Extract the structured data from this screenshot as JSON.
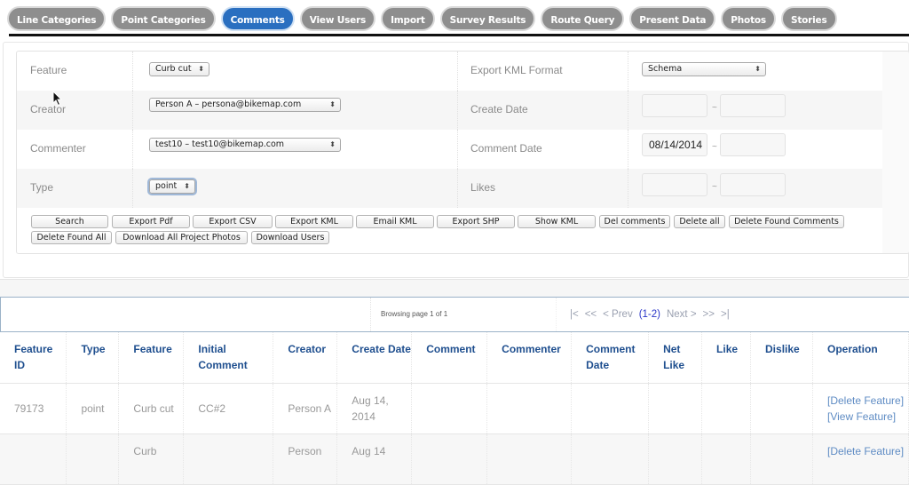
{
  "tabs": [
    {
      "label": "Line Categories",
      "active": false
    },
    {
      "label": "Point Categories",
      "active": false
    },
    {
      "label": "Comments",
      "active": true
    },
    {
      "label": "View Users",
      "active": false
    },
    {
      "label": "Import",
      "active": false
    },
    {
      "label": "Survey Results",
      "active": false
    },
    {
      "label": "Route Query",
      "active": false
    },
    {
      "label": "Present Data",
      "active": false
    },
    {
      "label": "Photos",
      "active": false
    },
    {
      "label": "Stories",
      "active": false
    }
  ],
  "filters": {
    "feature": {
      "label": "Feature",
      "value": "Curb cut"
    },
    "creator": {
      "label": "Creator",
      "value": "Person A – persona@bikemap.com"
    },
    "commenter": {
      "label": "Commenter",
      "value": "test10 – test10@bikemap.com"
    },
    "type": {
      "label": "Type",
      "value": "point"
    },
    "export_kml_format": {
      "label": "Export KML Format",
      "value": "Schema"
    },
    "create_date": {
      "label": "Create Date",
      "from": "",
      "to": ""
    },
    "comment_date": {
      "label": "Comment Date",
      "from": "08/14/2014",
      "to": ""
    },
    "likes": {
      "label": "Likes",
      "from": "",
      "to": ""
    },
    "range_separator": "~"
  },
  "buttons": {
    "search": "Search",
    "export_pdf": "Export Pdf",
    "export_csv": "Export CSV",
    "export_kml": "Export KML",
    "email_kml": "Email KML",
    "export_shp": "Export SHP",
    "show_kml": "Show KML",
    "del_comments": "Del comments",
    "delete_all": "Delete all",
    "delete_found_comments": "Delete Found Comments",
    "delete_found_all": "Delete Found All",
    "download_all_project_photos": "Download All Project Photos",
    "download_users": "Download Users"
  },
  "pager": {
    "browsing": "Browsing page 1 of 1",
    "first": "|<",
    "prev_block": "<<",
    "prev": "< Prev",
    "current": "(1-2)",
    "next": "Next >",
    "next_block": ">>",
    "last": ">|"
  },
  "table": {
    "headers": [
      "Feature ID",
      "Type",
      "Feature",
      "Initial Comment",
      "Creator",
      "Create Date",
      "Comment",
      "Commenter",
      "Comment Date",
      "Net Like",
      "Like",
      "Dislike",
      "Operation"
    ],
    "rows": [
      {
        "feature_id": "79173",
        "type": "point",
        "feature": "Curb cut",
        "initial_comment": "CC#2",
        "creator": "Person A",
        "create_date": "Aug 14, 2014",
        "comment": "",
        "commenter": "",
        "comment_date": "",
        "net_like": "",
        "like": "",
        "dislike": "",
        "ops": [
          "[Delete Feature]",
          "[View Feature]"
        ]
      },
      {
        "feature_id": "",
        "type": "",
        "feature": "Curb",
        "initial_comment": "",
        "creator": "Person",
        "create_date": "Aug 14",
        "comment": "",
        "commenter": "",
        "comment_date": "",
        "net_like": "",
        "like": "",
        "dislike": "",
        "ops": [
          "[Delete Feature]"
        ]
      }
    ]
  }
}
